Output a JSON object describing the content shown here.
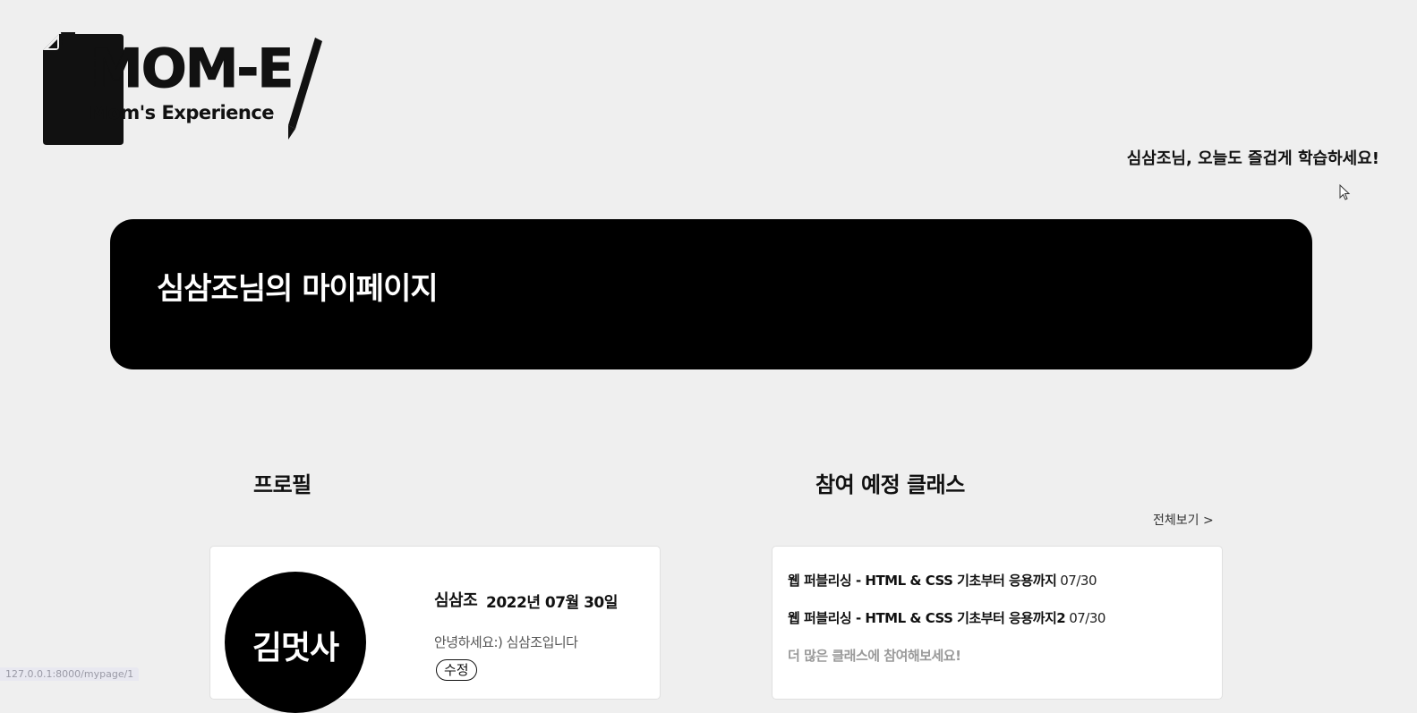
{
  "logo": {
    "title": "MOM-E",
    "subtitle": "Mom's Experience"
  },
  "header": {
    "greeting": "심삼조님, 오늘도 즐겁게 학습하세요!"
  },
  "banner": {
    "title": "심삼조님의 마이페이지"
  },
  "profile": {
    "section_title": "프로필",
    "avatar_label": "김멋사",
    "name": "심삼조",
    "date": "2022년 07월 30일",
    "bio": "안녕하세요:) 심삼조입니다",
    "edit_label": "수정"
  },
  "classes": {
    "section_title": "참여 예정 클래스",
    "view_all_label": "전체보기 >",
    "items": [
      {
        "title": "웹 퍼블리싱 - HTML & CSS 기초부터 응용까지",
        "date": "07/30"
      },
      {
        "title": "웹 퍼블리싱 - HTML & CSS 기초부터 응용까지2",
        "date": "07/30"
      }
    ],
    "more_label": "더 많은 클래스에 참여해보세요!"
  },
  "status_bar": {
    "url": "127.0.0.1:8000/mypage/1"
  }
}
